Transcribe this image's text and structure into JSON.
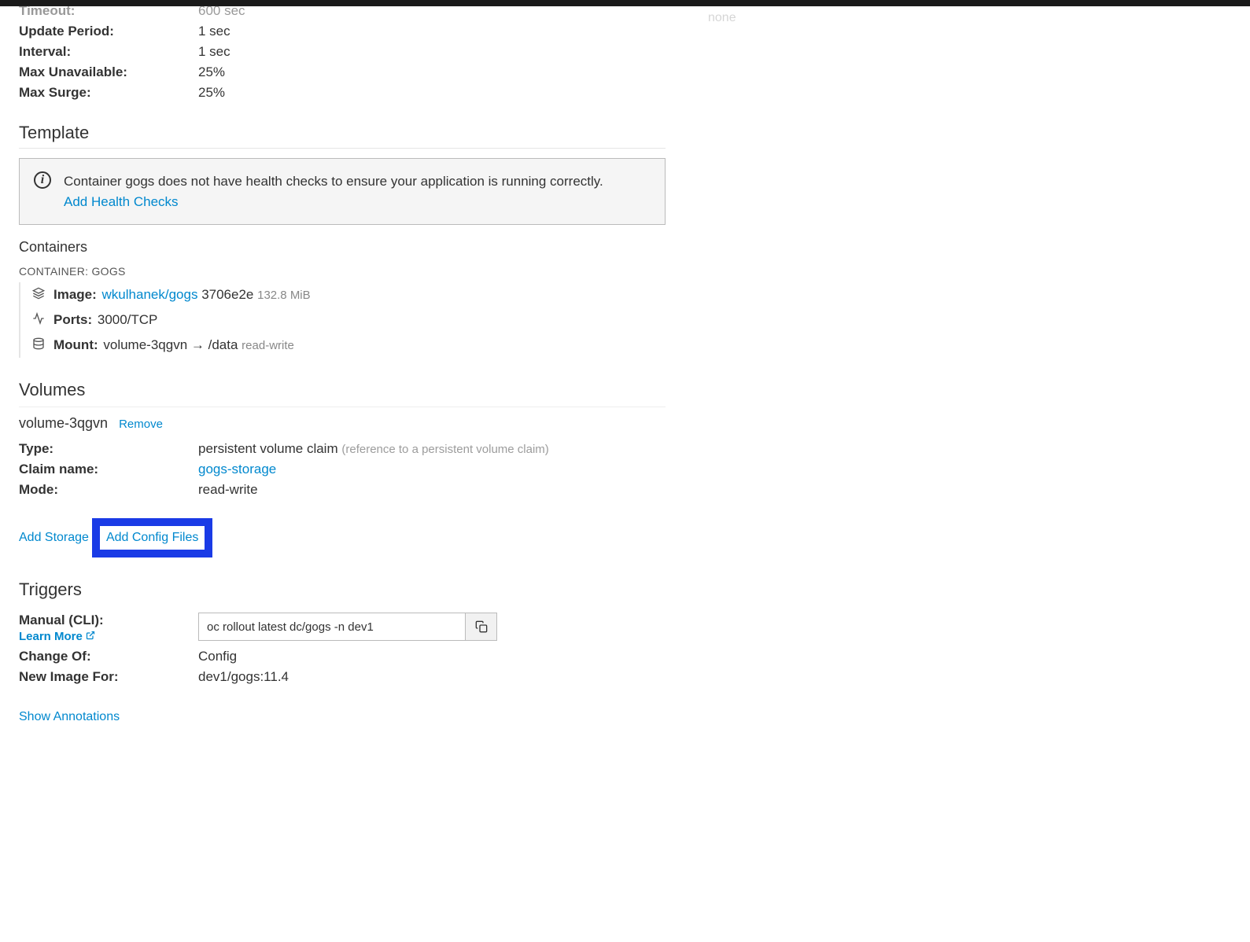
{
  "partialTop": {
    "timeout": {
      "label": "Timeout:",
      "value": "600 sec"
    },
    "updatePeriod": {
      "label": "Update Period:",
      "value": "1 sec"
    },
    "interval": {
      "label": "Interval:",
      "value": "1 sec"
    },
    "maxUnavailable": {
      "label": "Max Unavailable:",
      "value": "25%"
    },
    "maxSurge": {
      "label": "Max Surge:",
      "value": "25%"
    }
  },
  "rightStub": "none",
  "template": {
    "heading": "Template",
    "callout": {
      "text": "Container gogs does not have health checks to ensure your application is running correctly.",
      "link": "Add Health Checks"
    }
  },
  "containers": {
    "heading": "Containers",
    "label": "CONTAINER: GOGS",
    "image": {
      "label": "Image:",
      "link": "wkulhanek/gogs",
      "sha": "3706e2e",
      "size": "132.8 MiB"
    },
    "ports": {
      "label": "Ports:",
      "value": "3000/TCP"
    },
    "mount": {
      "label": "Mount:",
      "vol": "volume-3qgvn",
      "arrow": "→",
      "path": "/data",
      "mode": "read-write"
    }
  },
  "volumes": {
    "heading": "Volumes",
    "name": "volume-3qgvn",
    "removeLabel": "Remove",
    "type": {
      "label": "Type:",
      "value": "persistent volume claim",
      "hint": "(reference to a persistent volume claim)"
    },
    "claim": {
      "label": "Claim name:",
      "link": "gogs-storage"
    },
    "mode": {
      "label": "Mode:",
      "value": "read-write"
    }
  },
  "storageLinks": {
    "addStorage": "Add Storage",
    "addConfig": "Add Config Files"
  },
  "triggers": {
    "heading": "Triggers",
    "manual": {
      "label": "Manual (CLI):",
      "cmd": "oc rollout latest dc/gogs -n dev1",
      "learnMore": "Learn More"
    },
    "changeOf": {
      "label": "Change Of:",
      "value": "Config"
    },
    "newImage": {
      "label": "New Image For:",
      "value": "dev1/gogs:11.4"
    }
  },
  "annotationsLink": "Show Annotations"
}
